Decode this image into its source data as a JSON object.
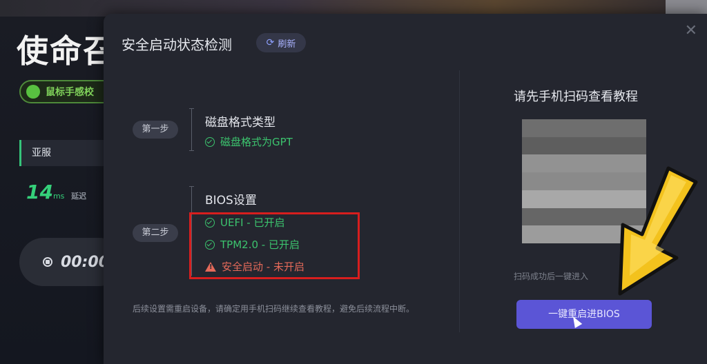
{
  "background_app": {
    "title": "使命召",
    "mouse_chip": "鼠标手感校",
    "region": "亚服",
    "latency_value": "14",
    "latency_unit": "ms",
    "latency_label": "延迟",
    "timer": "00:00"
  },
  "modal": {
    "title": "安全启动状态检测",
    "refresh_label": "刷新",
    "close_glyph": "✕",
    "refresh_glyph": "⟳"
  },
  "steps": [
    {
      "badge": "第一步",
      "title": "磁盘格式类型",
      "items": [
        {
          "text": "磁盘格式为GPT",
          "status": "ok"
        }
      ]
    },
    {
      "badge": "第二步",
      "title": "BIOS设置",
      "items": [
        {
          "text": "UEFI - 已开启",
          "status": "ok"
        },
        {
          "text": "TPM2.0 - 已开启",
          "status": "ok"
        },
        {
          "text": "安全启动 - 未开启",
          "status": "warn"
        }
      ]
    }
  ],
  "footnote": "后续设置需重启设备，请确定用手机扫码继续查看教程，避免后续流程中断。",
  "qr_panel": {
    "title": "请先手机扫码查看教程",
    "scan_tip": "扫码成功后一键进入",
    "button_label": "一键重启进BIOS"
  },
  "colors": {
    "accent": "#5b55d6",
    "ok": "#3cc46e",
    "warn": "#e56a5a",
    "highlight": "#d81e1e"
  }
}
